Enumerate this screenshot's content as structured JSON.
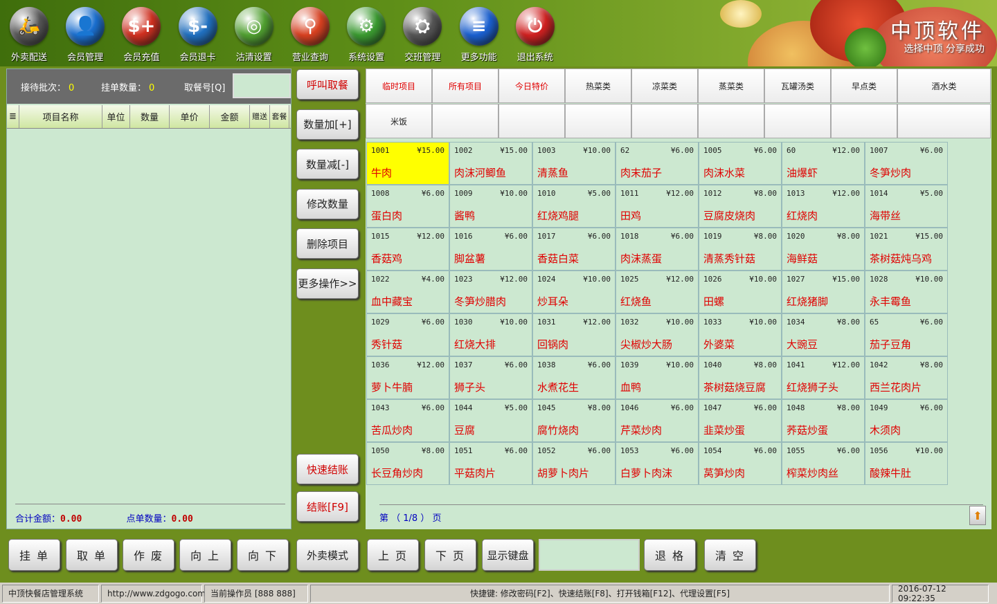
{
  "toolbar": [
    {
      "label": "外卖配送",
      "icon": "scooter-icon",
      "color": "#555555",
      "glyph": "🛵"
    },
    {
      "label": "会员管理",
      "icon": "member-icon",
      "color": "#1a6fd0",
      "glyph": "👤"
    },
    {
      "label": "会员充值",
      "icon": "recharge-card-icon",
      "color": "#d03020",
      "glyph": "$+"
    },
    {
      "label": "会员退卡",
      "icon": "refund-card-icon",
      "color": "#2070c0",
      "glyph": "$-"
    },
    {
      "label": "沽清设置",
      "icon": "plate-icon",
      "color": "#50a030",
      "glyph": "◎"
    },
    {
      "label": "营业查询",
      "icon": "magnifier-icon",
      "color": "#d84020",
      "glyph": "⚲"
    },
    {
      "label": "系统设置",
      "icon": "gear-icon",
      "color": "#3a9a30",
      "glyph": "⚙"
    },
    {
      "label": "交班管理",
      "icon": "shift-handover-icon",
      "color": "#555555",
      "glyph": "⛭"
    },
    {
      "label": "更多功能",
      "icon": "list-icon",
      "color": "#1a60d0",
      "glyph": "≡"
    },
    {
      "label": "退出系统",
      "icon": "power-icon",
      "color": "#d02020",
      "glyph": "⏻"
    }
  ],
  "brand": {
    "name": "中顶软件",
    "slogan": "选择中顶 分享成功"
  },
  "left": {
    "reception_label": "接待批次：",
    "reception_value": "0",
    "pending_label": "挂单数量：",
    "pending_value": "0",
    "ticket_label": "取餐号[Q]",
    "columns": [
      "项目名称",
      "单位",
      "数量",
      "单价",
      "金额",
      "赠送",
      "套餐"
    ],
    "total_label": "合计金额：",
    "total_value": "0.00",
    "count_label": "点单数量：",
    "count_value": "0.00"
  },
  "mid_buttons": [
    {
      "label": "呼叫取餐",
      "red": true
    },
    {
      "label": "数量加[+]",
      "red": false
    },
    {
      "label": "数量减[-]",
      "red": false
    },
    {
      "label": "修改数量",
      "red": false
    },
    {
      "label": "删除项目",
      "red": false
    },
    {
      "label": "更多操作>>",
      "red": false
    }
  ],
  "quick_checkout": "快速结账",
  "checkout": "结账[F9]",
  "categories_row1": [
    {
      "label": "临时项目",
      "red": true
    },
    {
      "label": "所有项目",
      "red": true
    },
    {
      "label": "今日特价",
      "red": true
    },
    {
      "label": "热菜类",
      "red": false
    },
    {
      "label": "凉菜类",
      "red": false
    },
    {
      "label": "蒸菜类",
      "red": false
    },
    {
      "label": "瓦罐汤类",
      "red": false
    },
    {
      "label": "早点类",
      "red": false
    },
    {
      "label": "酒水类",
      "red": false
    }
  ],
  "categories_row2": [
    "米饭",
    "",
    "",
    "",
    "",
    "",
    "",
    "",
    ""
  ],
  "items": [
    {
      "code": "1001",
      "price": "¥15.00",
      "name": "牛肉",
      "selected": true
    },
    {
      "code": "1002",
      "price": "¥15.00",
      "name": "肉沫河鲫鱼"
    },
    {
      "code": "1003",
      "price": "¥10.00",
      "name": "清蒸鱼"
    },
    {
      "code": "62",
      "price": "¥6.00",
      "name": "肉末茄子"
    },
    {
      "code": "1005",
      "price": "¥6.00",
      "name": "肉沫水菜"
    },
    {
      "code": "60",
      "price": "¥12.00",
      "name": "油爆虾"
    },
    {
      "code": "1007",
      "price": "¥6.00",
      "name": "冬笋炒肉"
    },
    {
      "code": "1008",
      "price": "¥6.00",
      "name": "蛋白肉"
    },
    {
      "code": "1009",
      "price": "¥10.00",
      "name": "酱鸭"
    },
    {
      "code": "1010",
      "price": "¥5.00",
      "name": "红烧鸡腿"
    },
    {
      "code": "1011",
      "price": "¥12.00",
      "name": "田鸡"
    },
    {
      "code": "1012",
      "price": "¥8.00",
      "name": "豆腐皮烧肉"
    },
    {
      "code": "1013",
      "price": "¥12.00",
      "name": "红烧肉"
    },
    {
      "code": "1014",
      "price": "¥5.00",
      "name": "海带丝"
    },
    {
      "code": "1015",
      "price": "¥12.00",
      "name": "香菇鸡"
    },
    {
      "code": "1016",
      "price": "¥6.00",
      "name": "脚盆薯"
    },
    {
      "code": "1017",
      "price": "¥6.00",
      "name": "香菇白菜"
    },
    {
      "code": "1018",
      "price": "¥6.00",
      "name": "肉沫蒸蛋"
    },
    {
      "code": "1019",
      "price": "¥8.00",
      "name": "清蒸秀针菇"
    },
    {
      "code": "1020",
      "price": "¥8.00",
      "name": "海鲜菇"
    },
    {
      "code": "1021",
      "price": "¥15.00",
      "name": "茶树菇炖乌鸡"
    },
    {
      "code": "1022",
      "price": "¥4.00",
      "name": "血中藏宝"
    },
    {
      "code": "1023",
      "price": "¥12.00",
      "name": "冬笋炒腊肉"
    },
    {
      "code": "1024",
      "price": "¥10.00",
      "name": "炒耳朵"
    },
    {
      "code": "1025",
      "price": "¥12.00",
      "name": "红烧鱼"
    },
    {
      "code": "1026",
      "price": "¥10.00",
      "name": "田螺"
    },
    {
      "code": "1027",
      "price": "¥15.00",
      "name": "红烧猪脚"
    },
    {
      "code": "1028",
      "price": "¥10.00",
      "name": "永丰霉鱼"
    },
    {
      "code": "1029",
      "price": "¥6.00",
      "name": "秀针菇"
    },
    {
      "code": "1030",
      "price": "¥10.00",
      "name": "红烧大排"
    },
    {
      "code": "1031",
      "price": "¥12.00",
      "name": "回锅肉"
    },
    {
      "code": "1032",
      "price": "¥10.00",
      "name": "尖椒炒大肠"
    },
    {
      "code": "1033",
      "price": "¥10.00",
      "name": "外婆菜"
    },
    {
      "code": "1034",
      "price": "¥8.00",
      "name": "大豌豆"
    },
    {
      "code": "65",
      "price": "¥6.00",
      "name": "茄子豆角"
    },
    {
      "code": "1036",
      "price": "¥12.00",
      "name": "萝卜牛腩"
    },
    {
      "code": "1037",
      "price": "¥6.00",
      "name": "狮子头"
    },
    {
      "code": "1038",
      "price": "¥6.00",
      "name": "水煮花生"
    },
    {
      "code": "1039",
      "price": "¥10.00",
      "name": "血鸭"
    },
    {
      "code": "1040",
      "price": "¥8.00",
      "name": "茶树菇烧豆腐"
    },
    {
      "code": "1041",
      "price": "¥12.00",
      "name": "红烧狮子头"
    },
    {
      "code": "1042",
      "price": "¥8.00",
      "name": "西兰花肉片"
    },
    {
      "code": "1043",
      "price": "¥6.00",
      "name": "苦瓜炒肉"
    },
    {
      "code": "1044",
      "price": "¥5.00",
      "name": "豆腐"
    },
    {
      "code": "1045",
      "price": "¥8.00",
      "name": "腐竹烧肉"
    },
    {
      "code": "1046",
      "price": "¥6.00",
      "name": "芹菜炒肉"
    },
    {
      "code": "1047",
      "price": "¥6.00",
      "name": "韭菜炒蛋"
    },
    {
      "code": "1048",
      "price": "¥8.00",
      "name": "荞菇炒蛋"
    },
    {
      "code": "1049",
      "price": "¥6.00",
      "name": "木须肉"
    },
    {
      "code": "1050",
      "price": "¥8.00",
      "name": "长豆角炒肉"
    },
    {
      "code": "1051",
      "price": "¥6.00",
      "name": "平菇肉片"
    },
    {
      "code": "1052",
      "price": "¥6.00",
      "name": "胡萝卜肉片"
    },
    {
      "code": "1053",
      "price": "¥6.00",
      "name": "白萝卜肉沫"
    },
    {
      "code": "1054",
      "price": "¥6.00",
      "name": "莴笋炒肉"
    },
    {
      "code": "1055",
      "price": "¥6.00",
      "name": "榨菜炒肉丝"
    },
    {
      "code": "1056",
      "price": "¥10.00",
      "name": "酸辣牛肚"
    }
  ],
  "pager": {
    "text": "第 （ 1/8 ） 页"
  },
  "bottom_buttons": [
    "挂 单",
    "取 单",
    "作 废",
    "向 上",
    "向 下",
    "外卖模式",
    "上 页",
    "下 页",
    "显示键盘",
    "退 格",
    "清 空"
  ],
  "status": {
    "system": "中顶快餐店管理系统",
    "url": "http://www.zdgogo.com",
    "operator": "当前操作员 [888 888]",
    "shortcuts": "快捷键:  修改密码[F2]、快速结账[F8]、打开钱箱[F12]、代理设置[F5]",
    "datetime": "2016-07-12 09:22:35"
  }
}
